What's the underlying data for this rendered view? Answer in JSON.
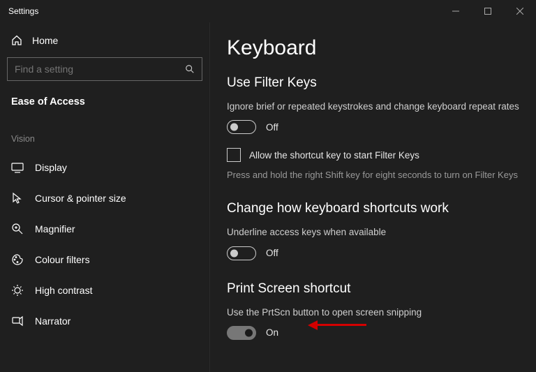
{
  "window": {
    "title": "Settings"
  },
  "sidebar": {
    "home": "Home",
    "search_placeholder": "Find a setting",
    "category": "Ease of Access",
    "section_label": "Vision",
    "items": [
      {
        "label": "Display"
      },
      {
        "label": "Cursor & pointer size"
      },
      {
        "label": "Magnifier"
      },
      {
        "label": "Colour filters"
      },
      {
        "label": "High contrast"
      },
      {
        "label": "Narrator"
      }
    ]
  },
  "main": {
    "title": "Keyboard",
    "filter_keys": {
      "heading": "Use Filter Keys",
      "desc": "Ignore brief or repeated keystrokes and change keyboard repeat rates",
      "toggle_state": "Off",
      "checkbox_label": "Allow the shortcut key to start Filter Keys",
      "hint": "Press and hold the right Shift key for eight seconds to turn on Filter Keys"
    },
    "shortcuts": {
      "heading": "Change how keyboard shortcuts work",
      "desc": "Underline access keys when available",
      "toggle_state": "Off"
    },
    "printscreen": {
      "heading": "Print Screen shortcut",
      "desc": "Use the PrtScn button to open screen snipping",
      "toggle_state": "On"
    }
  }
}
